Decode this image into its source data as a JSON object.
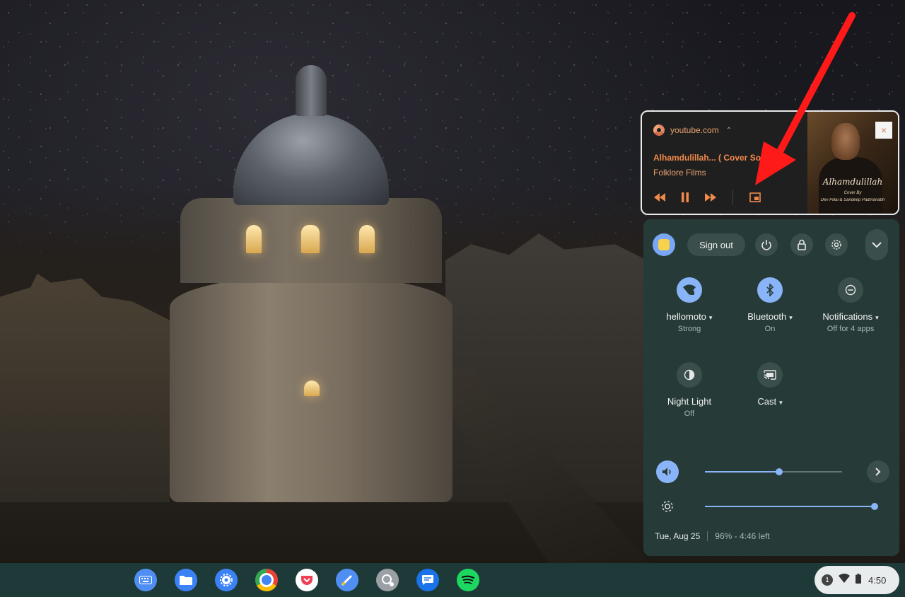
{
  "media_notification": {
    "source": "youtube.com",
    "title": "Alhamdulillah...  ( Cover Song )",
    "artist": "Folklore Films",
    "artwork": {
      "title": "Alhamdulillah",
      "subtitle": "Cover By",
      "credit": "Dev Pillai & Sandeep Padmanabh"
    },
    "controls": [
      "previous-track",
      "pause",
      "next-track",
      "picture-in-picture"
    ],
    "close_label": "×"
  },
  "quick_settings": {
    "sign_out_label": "Sign out",
    "tiles": [
      {
        "label": "hellomoto",
        "sub": "Strong",
        "has_dropdown": true,
        "active": true,
        "icon": "wifi-icon"
      },
      {
        "label": "Bluetooth",
        "sub": "On",
        "has_dropdown": true,
        "active": true,
        "icon": "bluetooth-icon"
      },
      {
        "label": "Notifications",
        "sub": "Off for 4 apps",
        "has_dropdown": true,
        "active": false,
        "icon": "do-not-disturb-icon"
      },
      {
        "label": "Night Light",
        "sub": "Off",
        "has_dropdown": false,
        "active": false,
        "icon": "night-light-icon"
      },
      {
        "label": "Cast",
        "sub": "",
        "has_dropdown": true,
        "active": false,
        "icon": "cast-icon"
      }
    ],
    "volume_level": 0.54,
    "brightness_level": 1.0,
    "date": "Tue, Aug 25",
    "battery": "96% - 4:46 left"
  },
  "shelf": {
    "apps": [
      "keyboard-app",
      "files-app",
      "settings-app",
      "chrome-browser",
      "pocket-app",
      "docs-app",
      "assistant-app",
      "messages-app",
      "spotify-app"
    ],
    "status": {
      "notification_count": "1",
      "time": "4:50"
    }
  },
  "colors": {
    "accent": "#8ab4f8",
    "panel": "#263b38",
    "media_text": "#e8a171",
    "shelf": "#1e3a38",
    "annotation_arrow": "#ff1a1a"
  }
}
